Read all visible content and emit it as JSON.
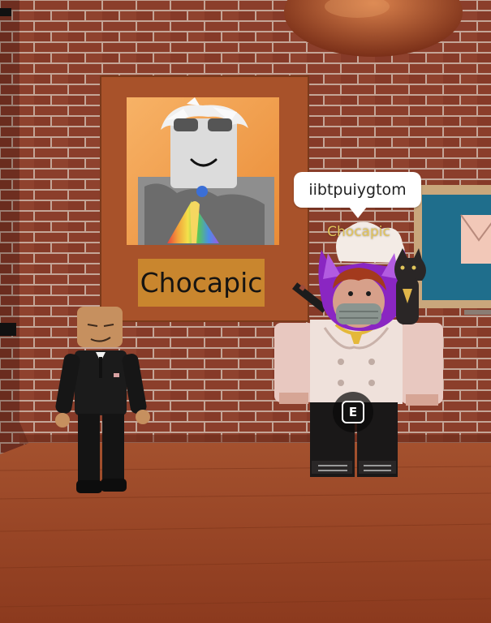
{
  "poster": {
    "caption": "Chocapic"
  },
  "player": {
    "chat_message": "iibtpuiygtom",
    "nametag": "Chocapic"
  },
  "interaction": {
    "key_label": "E"
  },
  "colors": {
    "brick": "#8a3d2a",
    "mortar": "#c7a79a",
    "floor": "#9a4527",
    "poster_frame": "#a8522a",
    "poster_caption_bg": "#c9862e",
    "nametag_text": "#e2c45a"
  }
}
